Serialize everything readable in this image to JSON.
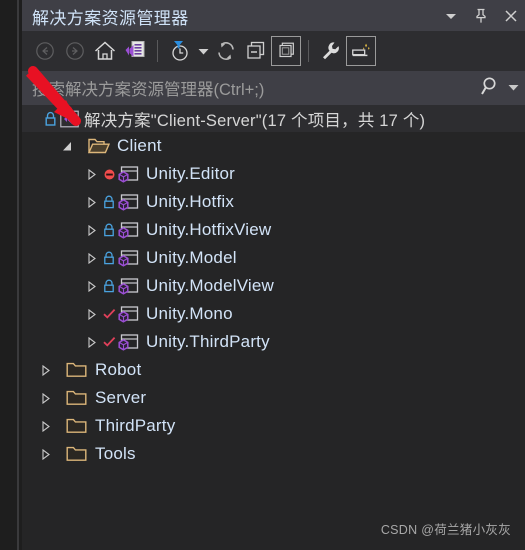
{
  "window": {
    "title": "解决方案资源管理器",
    "buttons": [
      {
        "name": "window-dropdown",
        "icon": "chevron-down-icon",
        "label": "▼"
      },
      {
        "name": "window-pin",
        "icon": "pin-icon",
        "label": "Pin"
      },
      {
        "name": "window-close",
        "icon": "close-icon",
        "label": "✕"
      }
    ]
  },
  "toolbar": {
    "items": [
      {
        "name": "back-button",
        "icon": "back-arrow-icon",
        "tooltip": "后退",
        "state": "disabled"
      },
      {
        "name": "forward-button",
        "icon": "forward-arrow-icon",
        "tooltip": "前进",
        "state": "disabled"
      },
      {
        "name": "home-button",
        "icon": "home-icon",
        "tooltip": "主页",
        "state": "enabled"
      },
      {
        "name": "properties-button",
        "icon": "properties-window-icon",
        "tooltip": "属性窗口",
        "state": "enabled"
      },
      {
        "name": "pending-changes-filter-button",
        "icon": "filter-clock-icon",
        "tooltip": "挂起的更改筛选器",
        "state": "enabled"
      },
      {
        "name": "filter-dropdown-button",
        "icon": "caret-down-icon",
        "tooltip": "筛选器",
        "state": "enabled"
      },
      {
        "name": "refresh-button",
        "icon": "refresh-icon",
        "tooltip": "刷新",
        "state": "enabled"
      },
      {
        "name": "collapse-all-button",
        "icon": "collapse-all-icon",
        "tooltip": "全部折叠",
        "state": "enabled"
      },
      {
        "name": "show-all-files-button",
        "icon": "show-all-files-icon",
        "tooltip": "显示所有文件",
        "state": "active"
      },
      {
        "name": "properties-wrench-button",
        "icon": "wrench-icon",
        "tooltip": "属性",
        "state": "enabled"
      },
      {
        "name": "preview-selected-items-button",
        "icon": "preview-file-icon",
        "tooltip": "预览选定的项",
        "state": "active"
      }
    ]
  },
  "search": {
    "placeholder": "搜索解决方案资源管理器(Ctrl+;)",
    "value": "",
    "search_icon": "search-icon",
    "dropdown_icon": "caret-down-icon"
  },
  "tree": {
    "solution": {
      "label": "解决方案\"Client-Server\"(17 个项目，共 17 个)",
      "lock_icon": "lock-icon",
      "solution_icon": "visual-studio-solution-icon",
      "selected": true
    },
    "nodes": [
      {
        "label": "Client",
        "type": "folder",
        "expanded": true,
        "depth": 1,
        "icon": "folder-open-icon"
      },
      {
        "label": "Unity.Editor",
        "type": "project",
        "expanded": false,
        "depth": 2,
        "icon": "csharp-project-icon",
        "badge": "unavailable-icon",
        "badge_color": "#f14c4c"
      },
      {
        "label": "Unity.Hotfix",
        "type": "project",
        "expanded": false,
        "depth": 2,
        "icon": "csharp-project-icon",
        "badge": "lock-icon",
        "badge_color": "#4aa3e0"
      },
      {
        "label": "Unity.HotfixView",
        "type": "project",
        "expanded": false,
        "depth": 2,
        "icon": "csharp-project-icon",
        "badge": "lock-icon",
        "badge_color": "#4aa3e0"
      },
      {
        "label": "Unity.Model",
        "type": "project",
        "expanded": false,
        "depth": 2,
        "icon": "csharp-project-icon",
        "badge": "lock-icon",
        "badge_color": "#4aa3e0"
      },
      {
        "label": "Unity.ModelView",
        "type": "project",
        "expanded": false,
        "depth": 2,
        "icon": "csharp-project-icon",
        "badge": "lock-icon",
        "badge_color": "#4aa3e0"
      },
      {
        "label": "Unity.Mono",
        "type": "project",
        "expanded": false,
        "depth": 2,
        "icon": "csharp-project-icon",
        "badge": "checkmark-icon",
        "badge_color": "#e0405a"
      },
      {
        "label": "Unity.ThirdParty",
        "type": "project",
        "expanded": false,
        "depth": 2,
        "icon": "csharp-project-icon",
        "badge": "checkmark-icon",
        "badge_color": "#e0405a"
      },
      {
        "label": "Robot",
        "type": "folder",
        "expanded": false,
        "depth": 1,
        "icon": "folder-closed-icon"
      },
      {
        "label": "Server",
        "type": "folder",
        "expanded": false,
        "depth": 1,
        "icon": "folder-closed-icon"
      },
      {
        "label": "ThirdParty",
        "type": "folder",
        "expanded": false,
        "depth": 1,
        "icon": "folder-closed-icon"
      },
      {
        "label": "Tools",
        "type": "folder",
        "expanded": false,
        "depth": 1,
        "icon": "folder-closed-icon"
      }
    ]
  },
  "annotation": {
    "arrow_color": "#e81123",
    "target": "solution-row"
  },
  "watermark": {
    "text": "CSDN @荷兰猪小灰灰"
  },
  "colors": {
    "panel_bg": "#252526",
    "titlebar_bg": "#3f3f46",
    "toolbar_bg": "#2d2d30",
    "text": "#d2e3f7",
    "folder": "#dcb67a",
    "accent_purple": "#9b4fd4"
  }
}
